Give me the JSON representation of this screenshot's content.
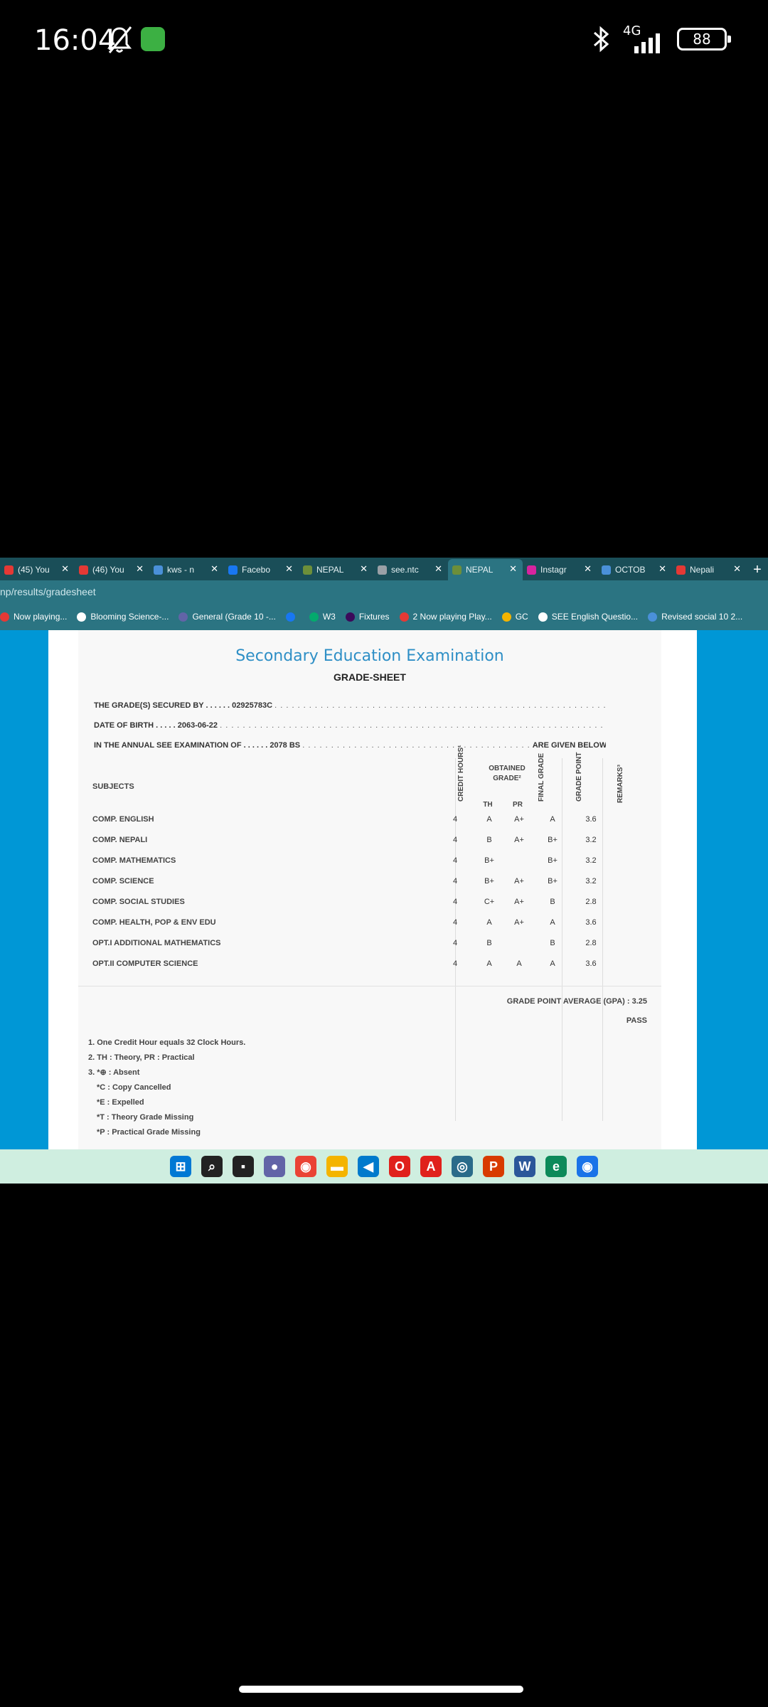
{
  "status_bar": {
    "time": "16:04",
    "network": "4G",
    "battery": "88"
  },
  "browser": {
    "tabs": [
      {
        "label": "(45) You",
        "color": "#e53935"
      },
      {
        "label": "(46) You",
        "color": "#e53935"
      },
      {
        "label": "kws - n",
        "color": "#4a90d9"
      },
      {
        "label": "Facebo",
        "color": "#1877f2"
      },
      {
        "label": "NEPAL",
        "color": "#6d8f3a"
      },
      {
        "label": "see.ntc",
        "color": "#9aa0a6"
      },
      {
        "label": "NEPAL",
        "color": "#6d8f3a",
        "active": true
      },
      {
        "label": "Instagr",
        "color": "#d6249f"
      },
      {
        "label": "OCTOB",
        "color": "#4a90d9"
      },
      {
        "label": "Nepali",
        "color": "#e53935"
      }
    ],
    "url": "np/results/gradesheet",
    "bookmarks": [
      {
        "label": "Now playing...",
        "color": "#e53935"
      },
      {
        "label": "Blooming Science-...",
        "color": "#ffffff"
      },
      {
        "label": "General (Grade 10 -...",
        "color": "#6264a7"
      },
      {
        "label": "",
        "color": "#1877f2"
      },
      {
        "label": "W3",
        "color": "#04aa6d"
      },
      {
        "label": "Fixtures",
        "color": "#3b0a5a"
      },
      {
        "label": "2 Now playing Play...",
        "color": "#e53935"
      },
      {
        "label": "GC",
        "color": "#f4b400"
      },
      {
        "label": "SEE English Questio...",
        "color": "#ffffff"
      },
      {
        "label": "Revised social 10 2...",
        "color": "#4a90d9"
      }
    ]
  },
  "gradesheet": {
    "title": "Secondary Education Examination",
    "subtitle": "GRADE-SHEET",
    "secured_by_label": "THE GRADE(S) SECURED BY . . . . . .",
    "symbol_no": "02925783C",
    "dob_label": "DATE OF BIRTH . . . . .",
    "dob": "2063-06-22",
    "exam_label": "IN THE ANNUAL SEE EXAMINATION OF . . . . . .",
    "exam_year": "2078 BS",
    "given_below": "ARE GIVEN BELOW . . .",
    "headers": {
      "subjects": "SUBJECTS",
      "credit_hours": "CREDIT HOURS¹",
      "obtained_grade": "OBTAINED GRADE²",
      "th": "TH",
      "pr": "PR",
      "final_grade": "FINAL GRADE",
      "grade_point": "GRADE POINT",
      "remarks": "REMARKS³"
    },
    "rows": [
      {
        "subject": "COMP. ENGLISH",
        "credit": "4",
        "th": "A",
        "pr": "A+",
        "final": "A",
        "gp": "3.6"
      },
      {
        "subject": "COMP. NEPALI",
        "credit": "4",
        "th": "B",
        "pr": "A+",
        "final": "B+",
        "gp": "3.2"
      },
      {
        "subject": "COMP. MATHEMATICS",
        "credit": "4",
        "th": "B+",
        "pr": "",
        "final": "B+",
        "gp": "3.2"
      },
      {
        "subject": "COMP. SCIENCE",
        "credit": "4",
        "th": "B+",
        "pr": "A+",
        "final": "B+",
        "gp": "3.2"
      },
      {
        "subject": "COMP. SOCIAL STUDIES",
        "credit": "4",
        "th": "C+",
        "pr": "A+",
        "final": "B",
        "gp": "2.8"
      },
      {
        "subject": "COMP. HEALTH, POP & ENV EDU",
        "credit": "4",
        "th": "A",
        "pr": "A+",
        "final": "A",
        "gp": "3.6"
      },
      {
        "subject": "OPT.I ADDITIONAL MATHEMATICS",
        "credit": "4",
        "th": "B",
        "pr": "",
        "final": "B",
        "gp": "2.8"
      },
      {
        "subject": "OPT.II COMPUTER SCIENCE",
        "credit": "4",
        "th": "A",
        "pr": "A",
        "final": "A",
        "gp": "3.6"
      }
    ],
    "gpa_text": "GRADE POINT AVERAGE (GPA) : 3.25",
    "result": "PASS",
    "notes": [
      "1. One Credit Hour equals 32 Clock Hours.",
      "2. TH : Theory, PR : Practical",
      "3. *⊕ : Absent",
      "*C : Copy Cancelled",
      "*E : Expelled",
      "*T : Theory Grade Missing",
      "*P : Practical Grade Missing"
    ]
  },
  "taskbar": [
    {
      "icon": "windows-start-icon",
      "glyph": "⊞",
      "color": "#0078d4"
    },
    {
      "icon": "search-icon",
      "glyph": "⌕",
      "color": "#222222"
    },
    {
      "icon": "task-view-icon",
      "glyph": "▪",
      "color": "#222222"
    },
    {
      "icon": "chat-icon",
      "glyph": "●",
      "color": "#6264a7"
    },
    {
      "icon": "chrome-icon",
      "glyph": "◉",
      "color": "#ea4335"
    },
    {
      "icon": "folder-icon",
      "glyph": "▬",
      "color": "#f4b400"
    },
    {
      "icon": "vscode-icon",
      "glyph": "◀",
      "color": "#007acc"
    },
    {
      "icon": "opera-icon",
      "glyph": "O",
      "color": "#e0201b"
    },
    {
      "icon": "acrobat-icon",
      "glyph": "A",
      "color": "#e0201b"
    },
    {
      "icon": "search-app-icon",
      "glyph": "◎",
      "color": "#2a6b8a"
    },
    {
      "icon": "pdf-icon",
      "glyph": "P",
      "color": "#d83b01"
    },
    {
      "icon": "word-icon",
      "glyph": "W",
      "color": "#2b579a"
    },
    {
      "icon": "edge-icon",
      "glyph": "e",
      "color": "#0c8a5a"
    },
    {
      "icon": "chrome-beta-icon",
      "glyph": "◉",
      "color": "#1a73e8"
    }
  ]
}
